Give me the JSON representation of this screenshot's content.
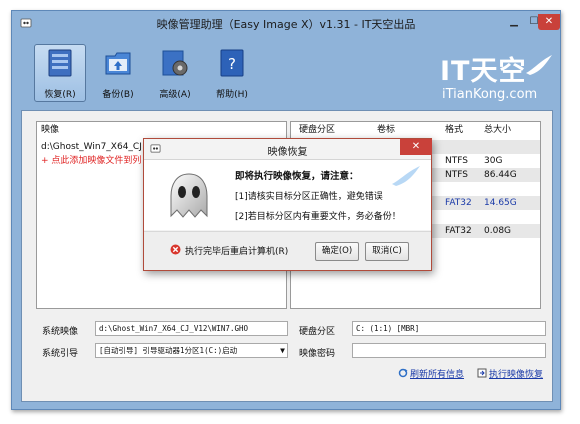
{
  "window": {
    "title": "映像管理助理（Easy Image X）v1.31 - IT天空出品"
  },
  "toolbar": {
    "items": [
      {
        "label": "恢复(R)",
        "icon": "document-restore-icon",
        "active": true
      },
      {
        "label": "备份(B)",
        "icon": "folder-backup-icon",
        "active": false
      },
      {
        "label": "高级(A)",
        "icon": "gear-advanced-icon",
        "active": false
      },
      {
        "label": "帮助(H)",
        "icon": "help-book-icon",
        "active": false
      }
    ]
  },
  "logo": {
    "text": "IT天空",
    "subtext": "iTianKong.com"
  },
  "image_list": {
    "header": "映像",
    "rows": [
      {
        "text": "d:\\Ghost_Win7_X64_CJ"
      },
      {
        "text": "+ 点此添加映像文件到列"
      }
    ]
  },
  "partition_table": {
    "columns": [
      "硬盘分区",
      "卷标",
      "格式",
      "总大小"
    ],
    "rows": [
      {
        "format": "NTFS",
        "size": "30G"
      },
      {
        "format": "NTFS",
        "size": "86.44G"
      },
      {
        "format": "",
        "size": ""
      },
      {
        "format": "FAT32",
        "size": "14.65G"
      },
      {
        "format": "",
        "size": ""
      },
      {
        "format": "FAT32",
        "size": "0.08G"
      }
    ]
  },
  "form": {
    "system_image_label": "系统映像",
    "system_image_value": "d:\\Ghost_Win7_X64_CJ_V12\\WIN7.GHO",
    "system_boot_label": "系统引导",
    "system_boot_value": "[自动引导] 引导驱动器1分区1(C:)启动",
    "disk_partition_label": "硬盘分区",
    "disk_partition_value": "C: (1:1)  [MBR]",
    "image_password_label": "映像密码",
    "image_password_value": ""
  },
  "links": {
    "refresh": "刷新所有信息",
    "execute": "执行映像恢复"
  },
  "dialog": {
    "title": "映像恢复",
    "heading": "即将执行映像恢复，请注意：",
    "line1": "[1]请核实目标分区正确性，避免错误",
    "line2": "[2]若目标分区内有重要文件，务必备份！",
    "checkbox_label": "执行完毕后重启计算机(R)",
    "ok_label": "确定(O)",
    "cancel_label": "取消(C)"
  },
  "colors": {
    "window_frame": "#8fb3d9",
    "close_red": "#c9413a",
    "link_blue": "#1a3aa8",
    "hint_red": "#e02424"
  }
}
